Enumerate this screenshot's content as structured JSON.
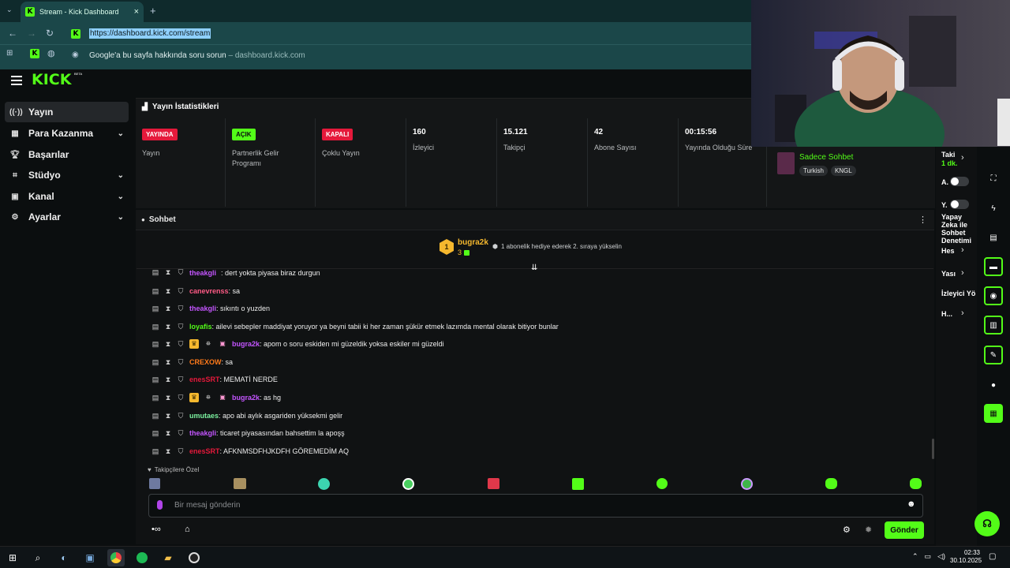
{
  "browser": {
    "tab_title": "Stream - Kick Dashboard",
    "tab_close": "×",
    "new_tab": "+",
    "url": "https://dashboard.kick.com/stream",
    "suggestion_text": "Google'a bu sayfa hakkında soru sorun",
    "suggestion_domain": "dashboard.kick.com"
  },
  "kick": {
    "logo": "KICK",
    "beta": "BETA"
  },
  "sidebar": {
    "items": [
      {
        "label": "Yayın",
        "icon": "broadcast-icon",
        "active": true,
        "chevron": false
      },
      {
        "label": "Para Kazanma",
        "icon": "money-icon",
        "chevron": true
      },
      {
        "label": "Başarılar",
        "icon": "trophy-icon",
        "chevron": false
      },
      {
        "label": "Stüdyo",
        "icon": "studio-icon",
        "chevron": true
      },
      {
        "label": "Kanal",
        "icon": "channel-icon",
        "chevron": true
      },
      {
        "label": "Ayarlar",
        "icon": "gear-icon",
        "chevron": true
      }
    ]
  },
  "stats": {
    "title": "Yayın İstatistikleri",
    "cells": [
      {
        "badge": "YAYINDA",
        "badge_color": "red",
        "label": "Yayın"
      },
      {
        "badge": "AÇIK",
        "badge_color": "green",
        "label": "Partnerlik Gelir Programı"
      },
      {
        "badge": "KAPALI",
        "badge_color": "red",
        "label": "Çoklu Yayın"
      },
      {
        "value": "160",
        "label": "İzleyici"
      },
      {
        "value": "15.121",
        "label": "Takipçi"
      },
      {
        "value": "42",
        "label": "Abone Sayısı"
      },
      {
        "value": "00:15:56",
        "label": "Yayında Olduğu Süre"
      }
    ],
    "mode": "Sadece Sohbet",
    "tags": [
      "Turkish",
      "KNGL"
    ]
  },
  "chat": {
    "title": "Sohbet",
    "top_gifter": {
      "rank": "1",
      "name": "bugra2k",
      "count": "3"
    },
    "gift_prompt": "1 abonelik hediye ederek 2. sıraya yükselin",
    "partial_line": {
      "user": "theakgli",
      "text": ": dert yokta piyasa biraz durgun"
    },
    "messages": [
      {
        "user": "canevrenss",
        "color": "#ff5b86",
        "text": ": sa",
        "extra": false
      },
      {
        "user": "theakgli",
        "color": "#c455ff",
        "text": ": sıkıntı o yuzden",
        "extra": false
      },
      {
        "user": "loyafis",
        "color": "#53fc18",
        "text": ": ailevi sebepler maddiyat yoruyor ya beyni tabii ki her zaman şükür etmek lazımda mental olarak bitiyor bunlar",
        "extra": false
      },
      {
        "user": "bugra2k",
        "color": "#c455ff",
        "text": ": apom o soru eskiden mi güzeldik yoksa eskiler mi güzeldi",
        "extra": true
      },
      {
        "user": "CREXOW",
        "color": "#ff7a1a",
        "text": ": sa",
        "extra": false
      },
      {
        "user": "enesSRT",
        "color": "#e5193b",
        "text": ": MEMATİ NERDE",
        "extra": false
      },
      {
        "user": "bugra2k",
        "color": "#c455ff",
        "text": ": as hg",
        "extra": true
      },
      {
        "user": "umutaes",
        "color": "#7cf2a0",
        "text": ": apo abi aylık asgariden yüksekmi gelir",
        "extra": false
      },
      {
        "user": "theakgli",
        "color": "#c455ff",
        "text": ": ticaret piyasasından bahsettim la apoşş",
        "extra": false
      },
      {
        "user": "enesSRT",
        "color": "#e5193b",
        "text": ": AFKNMSDFHJKDFH GÖREMEDİM AQ",
        "extra": false
      }
    ],
    "emote_label": "Takipçilere Özel",
    "input_placeholder": "Bir mesaj gönderin",
    "send_label": "Gönder"
  },
  "right_panel": {
    "items": [
      "Taki",
      "1 dk.",
      "A.",
      "Y.",
      "Yapay Zeka ile Sohbet Denetimi",
      "Hes",
      "Yası",
      "İzleyici Yö",
      "H..."
    ]
  },
  "taskbar": {
    "time": "02:33",
    "date": "30.10.2025"
  }
}
